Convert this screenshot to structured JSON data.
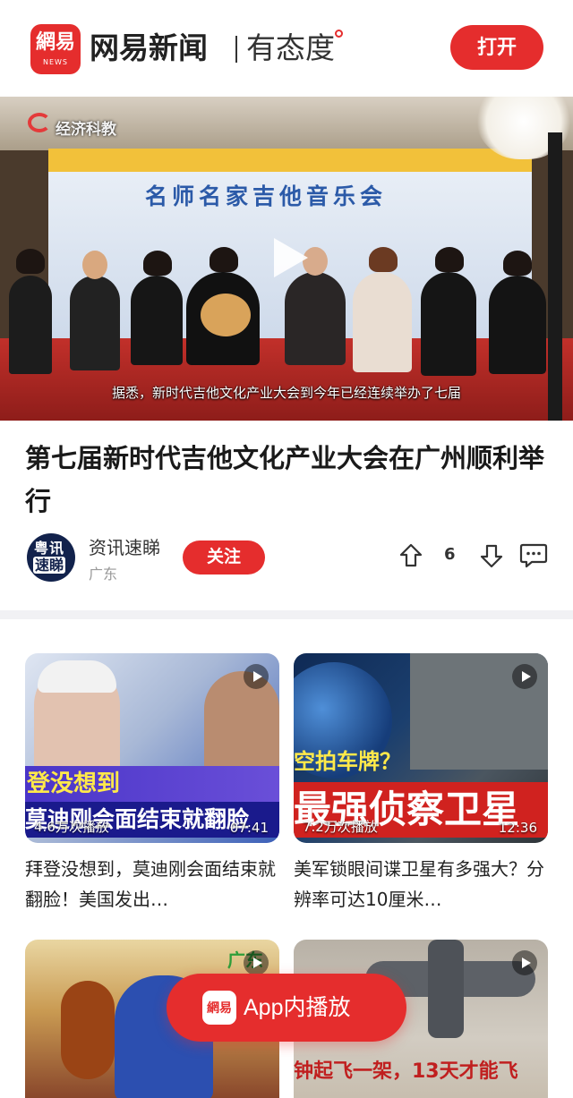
{
  "header": {
    "logo_text": "網易",
    "logo_subtext": "NEWS",
    "brand": "网易新闻",
    "slogan": "有态度",
    "open_label": "打开"
  },
  "video": {
    "channel_logo": "经济科教",
    "banner_title": "名师名家吉他音乐会",
    "subtitle": "据悉，新时代吉他文化产业大会到今年已经连续举办了七届"
  },
  "article": {
    "title": "第七届新时代吉他文化产业大会在广州顺利举行",
    "author": {
      "avatar_line1": "粤讯",
      "avatar_line2": "速睇",
      "name": "资讯速睇",
      "region": "广东",
      "follow_label": "关注"
    },
    "vote_count": "6",
    "icons": [
      "arrow-up-icon",
      "arrow-down-icon",
      "comment-icon"
    ]
  },
  "cards": [
    {
      "thumb_caption_top": "登没想到",
      "thumb_caption_bottom": "莫迪刚会面结束就翻脸",
      "views": "4.6万次播放",
      "duration": "07:41",
      "title": "拜登没想到，莫迪刚会面结束就翻脸！美国发出…"
    },
    {
      "thumb_caption_top": "空拍车牌？",
      "thumb_caption_bottom": "最强侦察卫星",
      "views": "7.2万次播放",
      "duration": "12:36",
      "title": "美军锁眼间谍卫星有多强大？分辨率可达10厘米…"
    },
    {
      "thumb_caption_top": "广东",
      "thumb_caption_bottom": "",
      "views": "",
      "duration": "",
      "title": ""
    },
    {
      "thumb_caption_top": "钟起飞一架，13天才能飞",
      "thumb_caption_bottom": "",
      "views": "",
      "duration": "",
      "title": ""
    }
  ],
  "app_play": {
    "label": "App内播放",
    "logo_text": "網易"
  },
  "colors": {
    "accent": "#e52d2d",
    "author_avatar": "#12224c"
  }
}
